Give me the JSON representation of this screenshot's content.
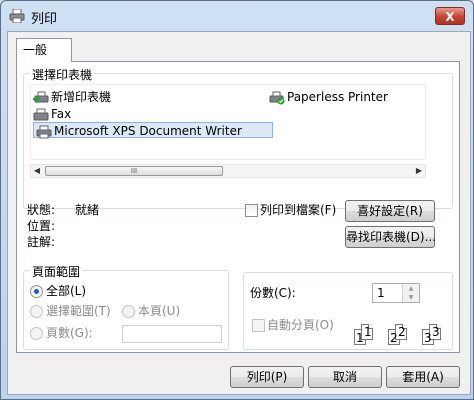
{
  "window": {
    "title": "列印",
    "close_label": "X"
  },
  "tabs": [
    {
      "label": "一般"
    }
  ],
  "select_printer": {
    "legend": "選擇印表機",
    "printers": [
      {
        "name": "新增印表機",
        "icon": "add-printer-icon"
      },
      {
        "name": "Paperless Printer",
        "icon": "printer-check-icon"
      },
      {
        "name": "Fax",
        "icon": "fax-icon"
      },
      {
        "name": "Microsoft XPS Document Writer",
        "icon": "printer-icon",
        "selected": true
      }
    ],
    "scroll_thumb_grip": "III"
  },
  "status": {
    "status_label": "狀態:",
    "status_value": "就緒",
    "location_label": "位置:",
    "location_value": "",
    "comment_label": "註解:",
    "comment_value": ""
  },
  "print_to_file": {
    "label": "列印到檔案(F)",
    "checked": false
  },
  "buttons": {
    "preferences": "喜好設定(R)",
    "find_printer": "尋找印表機(D)...",
    "print": "列印(P)",
    "cancel": "取消",
    "apply": "套用(A)"
  },
  "page_range": {
    "legend": "頁面範圍",
    "all": "全部(L)",
    "selection": "選擇範圍(T)",
    "current_page": "本頁(U)",
    "pages": "頁數(G):",
    "pages_value": ""
  },
  "copies": {
    "label": "份數(C):",
    "value": "1",
    "collate_label": "自動分頁(O)",
    "collate_checked": false,
    "collate_pages": [
      "1",
      "1",
      "2",
      "2",
      "3",
      "3"
    ]
  }
}
